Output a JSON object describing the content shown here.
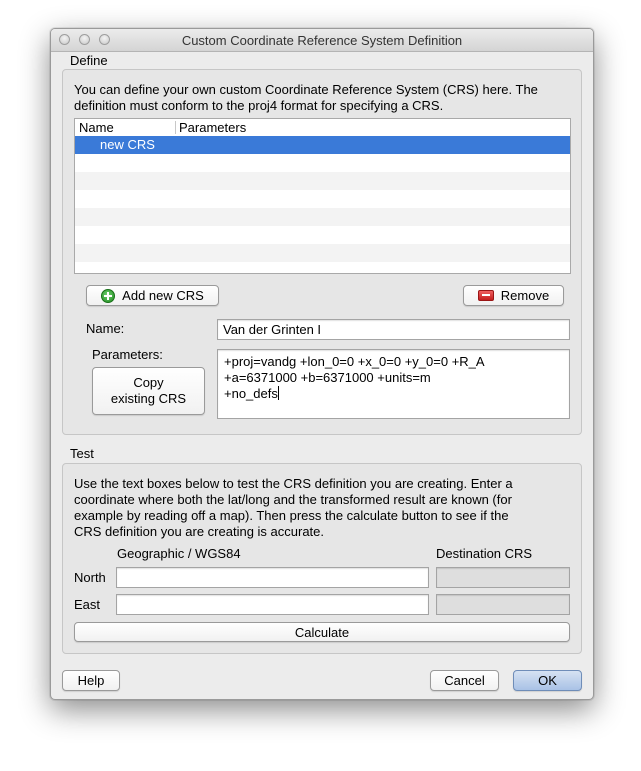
{
  "window": {
    "title": "Custom Coordinate Reference System Definition"
  },
  "define": {
    "section_label": "Define",
    "description_line1": "You can define your own custom Coordinate Reference System (CRS) here. The",
    "description_line2": "definition must conform to the proj4 format for specifying a CRS.",
    "list": {
      "columns": [
        "Name",
        "Parameters"
      ],
      "rows": [
        {
          "name": "new CRS",
          "parameters": "",
          "selected": true
        }
      ]
    },
    "add_button": "Add new CRS",
    "remove_button": "Remove",
    "name_label": "Name:",
    "name_value": "Van der Grinten I",
    "parameters_label": "Parameters:",
    "copy_button_line1": "Copy",
    "copy_button_line2": "existing CRS",
    "parameters_lines": [
      "+proj=vandg +lon_0=0 +x_0=0 +y_0=0 +R_A",
      "+a=6371000 +b=6371000 +units=m",
      "+no_defs"
    ]
  },
  "test": {
    "section_label": "Test",
    "description_lines": [
      "Use the text boxes below to test the CRS definition you are creating. Enter a",
      "coordinate where both the lat/long and the transformed result are known (for",
      "example by reading off a map). Then press the calculate button to see if the",
      "CRS definition you are creating is accurate."
    ],
    "geographic_header": "Geographic / WGS84",
    "destination_header": "Destination CRS",
    "north_label": "North",
    "east_label": "East",
    "north_value": "",
    "east_value": "",
    "calculate_button": "Calculate"
  },
  "footer": {
    "help_button": "Help",
    "cancel_button": "Cancel",
    "ok_button": "OK"
  },
  "colors": {
    "selection": "#3a7ad8",
    "window_bg": "#ececec",
    "group_bg": "#e6e6e6"
  }
}
